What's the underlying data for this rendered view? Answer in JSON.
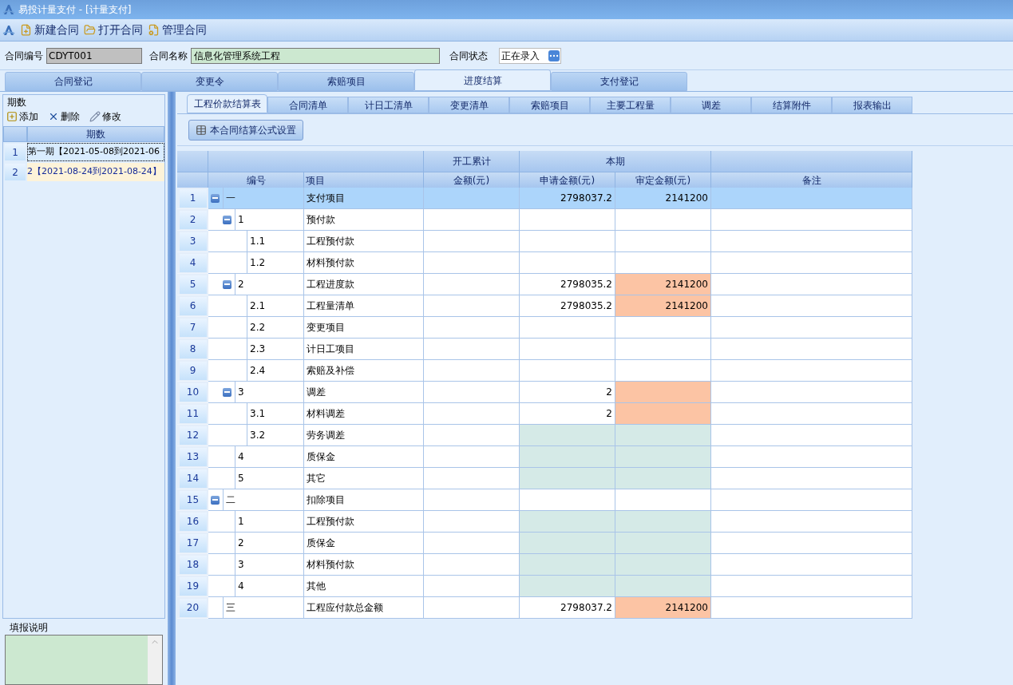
{
  "window": {
    "title": "易投计量支付 - [计量支付]"
  },
  "toolbar": [
    {
      "kind": "new",
      "label": "新建合同"
    },
    {
      "kind": "open",
      "label": "打开合同"
    },
    {
      "kind": "manage",
      "label": "管理合同"
    }
  ],
  "contract": {
    "number_label": "合同编号",
    "number": "CDYT001",
    "name_label": "合同名称",
    "name": "信息化管理系统工程",
    "status_label": "合同状态",
    "status": "正在录入"
  },
  "main_tabs": [
    {
      "label": "合同登记",
      "selected": false
    },
    {
      "label": "变更令",
      "selected": false
    },
    {
      "label": "索赔项目",
      "selected": false
    },
    {
      "label": "进度结算",
      "selected": true
    },
    {
      "label": "支付登记",
      "selected": false
    }
  ],
  "periods": {
    "title": "期数",
    "actions": [
      {
        "kind": "add",
        "label": "添加"
      },
      {
        "kind": "delete",
        "label": "删除"
      },
      {
        "kind": "edit",
        "label": "修改"
      }
    ],
    "column": "期数",
    "rows": [
      {
        "number": "1",
        "label": "第一期【2021-05-08到2021-06",
        "selected": true
      },
      {
        "number": "2",
        "label": "2【2021-08-24到2021-08-24】",
        "selected": false
      }
    ]
  },
  "notes": {
    "title": "填报说明"
  },
  "sub_tabs": [
    {
      "label": "工程价款结算表",
      "selected": true
    },
    {
      "label": "合同清单",
      "selected": false
    },
    {
      "label": "计日工清单",
      "selected": false
    },
    {
      "label": "变更清单",
      "selected": false
    },
    {
      "label": "索赔项目",
      "selected": false
    },
    {
      "label": "主要工程量",
      "selected": false
    },
    {
      "label": "调差",
      "selected": false
    },
    {
      "label": "结算附件",
      "selected": false
    },
    {
      "label": "报表输出",
      "selected": false
    }
  ],
  "formula_button": "本合同结算公式设置",
  "table": {
    "group_headers": {
      "cumulative": "开工累计",
      "current": "本期"
    },
    "columns": [
      "编号",
      "项目",
      "金额(元)",
      "申请金额(元)",
      "审定金额(元)",
      "备注"
    ],
    "rows": [
      {
        "row_number": "1",
        "code": "一",
        "item": "支付项目",
        "applied": "2798037.2",
        "approved": "2141200",
        "flagged": false,
        "locked": false,
        "selected": true,
        "expanded": true,
        "children": [
          {
            "row_number": "2",
            "code": "1",
            "item": "预付款",
            "flagged": false,
            "locked": false,
            "selected": false,
            "expanded": true,
            "children": [
              {
                "row_number": "3",
                "code": "1.1",
                "item": "工程预付款",
                "flagged": false,
                "locked": false,
                "selected": false
              },
              {
                "row_number": "4",
                "code": "1.2",
                "item": "材料预付款",
                "flagged": false,
                "locked": false,
                "selected": false
              }
            ]
          },
          {
            "row_number": "5",
            "code": "2",
            "item": "工程进度款",
            "applied": "2798035.2",
            "approved": "2141200",
            "flagged": true,
            "locked": false,
            "selected": false,
            "expanded": true,
            "children": [
              {
                "row_number": "6",
                "code": "2.1",
                "item": "工程量清单",
                "applied": "2798035.2",
                "approved": "2141200",
                "flagged": true,
                "locked": false,
                "selected": false
              },
              {
                "row_number": "7",
                "code": "2.2",
                "item": "变更项目",
                "flagged": false,
                "locked": false,
                "selected": false
              },
              {
                "row_number": "8",
                "code": "2.3",
                "item": "计日工项目",
                "flagged": false,
                "locked": false,
                "selected": false
              },
              {
                "row_number": "9",
                "code": "2.4",
                "item": "索赔及补偿",
                "flagged": false,
                "locked": false,
                "selected": false
              }
            ]
          },
          {
            "row_number": "10",
            "code": "3",
            "item": "调差",
            "applied": "2",
            "flagged": true,
            "locked": false,
            "selected": false,
            "expanded": true,
            "children": [
              {
                "row_number": "11",
                "code": "3.1",
                "item": "材料调差",
                "applied": "2",
                "flagged": true,
                "locked": false,
                "selected": false
              },
              {
                "row_number": "12",
                "code": "3.2",
                "item": "劳务调差",
                "flagged": false,
                "locked": true,
                "selected": false
              }
            ]
          },
          {
            "row_number": "13",
            "code": "4",
            "item": "质保金",
            "flagged": false,
            "locked": true,
            "selected": false
          },
          {
            "row_number": "14",
            "code": "5",
            "item": "其它",
            "flagged": false,
            "locked": true,
            "selected": false
          }
        ]
      },
      {
        "row_number": "15",
        "code": "二",
        "item": "扣除项目",
        "flagged": false,
        "locked": false,
        "selected": false,
        "expanded": true,
        "children": [
          {
            "row_number": "16",
            "code": "1",
            "item": "工程预付款",
            "flagged": false,
            "locked": true,
            "selected": false
          },
          {
            "row_number": "17",
            "code": "2",
            "item": "质保金",
            "flagged": false,
            "locked": true,
            "selected": false
          },
          {
            "row_number": "18",
            "code": "3",
            "item": "材料预付款",
            "flagged": false,
            "locked": true,
            "selected": false
          },
          {
            "row_number": "19",
            "code": "4",
            "item": "其他",
            "flagged": false,
            "locked": true,
            "selected": false
          }
        ]
      },
      {
        "row_number": "20",
        "code": "三",
        "item": "工程应付款总金额",
        "applied": "2798037.2",
        "approved": "2141200",
        "flagged": true,
        "locked": false,
        "selected": false
      }
    ]
  }
}
